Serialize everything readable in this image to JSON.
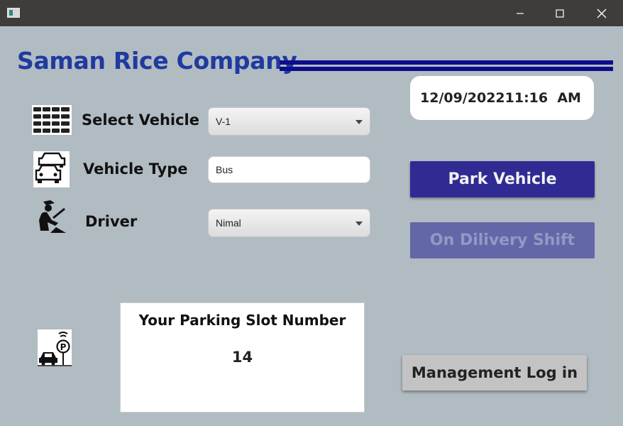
{
  "window": {
    "minimize_icon": "minimize-icon",
    "maximize_icon": "maximize-icon",
    "close_icon": "close-icon"
  },
  "header": {
    "company_name": "Saman Rice Company",
    "accent_color": "#1f3aa0"
  },
  "form": {
    "select_vehicle": {
      "label": "Select Vehicle",
      "value": "V-1",
      "icon": "vehicles-grid-icon"
    },
    "vehicle_type": {
      "label": "Vehicle Type",
      "value": "Bus",
      "icon": "cars-icon"
    },
    "driver": {
      "label": "Driver",
      "value": "Nimal",
      "icon": "driver-icon"
    }
  },
  "datetime": {
    "date": "12/09/2022",
    "time": "11:16  AM"
  },
  "actions": {
    "park_vehicle": "Park Vehicle",
    "on_delivery_shift": "On Dilivery Shift",
    "management_login": "Management Log in",
    "primary_color": "#2f2b93",
    "disabled_color": "#6367a8"
  },
  "parking": {
    "heading": "Your Parking Slot Number",
    "slot_number": "14",
    "icon": "parking-icon"
  }
}
